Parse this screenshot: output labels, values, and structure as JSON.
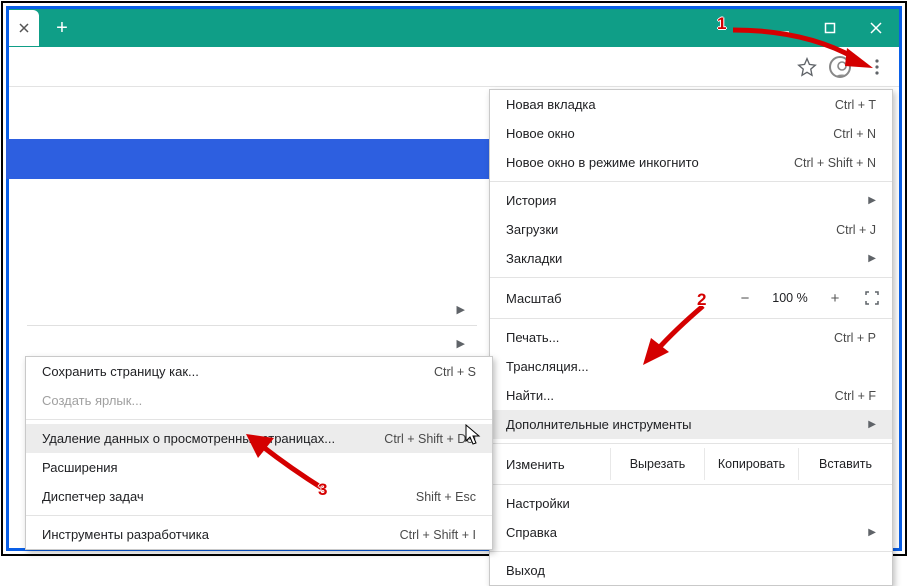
{
  "annotations": {
    "n1": "1",
    "n2": "2",
    "n3": "3"
  },
  "mainMenu": {
    "newTab": {
      "label": "Новая вкладка",
      "shortcut": "Ctrl + T"
    },
    "newWindow": {
      "label": "Новое окно",
      "shortcut": "Ctrl + N"
    },
    "incognito": {
      "label": "Новое окно в режиме инкогнито",
      "shortcut": "Ctrl + Shift + N"
    },
    "history": {
      "label": "История"
    },
    "downloads": {
      "label": "Загрузки",
      "shortcut": "Ctrl + J"
    },
    "bookmarks": {
      "label": "Закладки"
    },
    "zoom": {
      "label": "Масштаб",
      "minus": "−",
      "value": "100 %",
      "plus": "+"
    },
    "print": {
      "label": "Печать...",
      "shortcut": "Ctrl + P"
    },
    "cast": {
      "label": "Трансляция..."
    },
    "find": {
      "label": "Найти...",
      "shortcut": "Ctrl + F"
    },
    "moreTools": {
      "label": "Дополнительные инструменты"
    },
    "edit": {
      "label": "Изменить",
      "cut": "Вырезать",
      "copy": "Копировать",
      "paste": "Вставить"
    },
    "settings": {
      "label": "Настройки"
    },
    "help": {
      "label": "Справка"
    },
    "exit": {
      "label": "Выход"
    }
  },
  "subMenu": {
    "savePage": {
      "label": "Сохранить страницу как...",
      "shortcut": "Ctrl + S"
    },
    "shortcut": {
      "label": "Создать ярлык..."
    },
    "clearData": {
      "label": "Удаление данных о просмотренных страницах...",
      "shortcut": "Ctrl + Shift + Del"
    },
    "extensions": {
      "label": "Расширения"
    },
    "taskMgr": {
      "label": "Диспетчер задач",
      "shortcut": "Shift + Esc"
    },
    "devTools": {
      "label": "Инструменты разработчика",
      "shortcut": "Ctrl + Shift + I"
    }
  }
}
